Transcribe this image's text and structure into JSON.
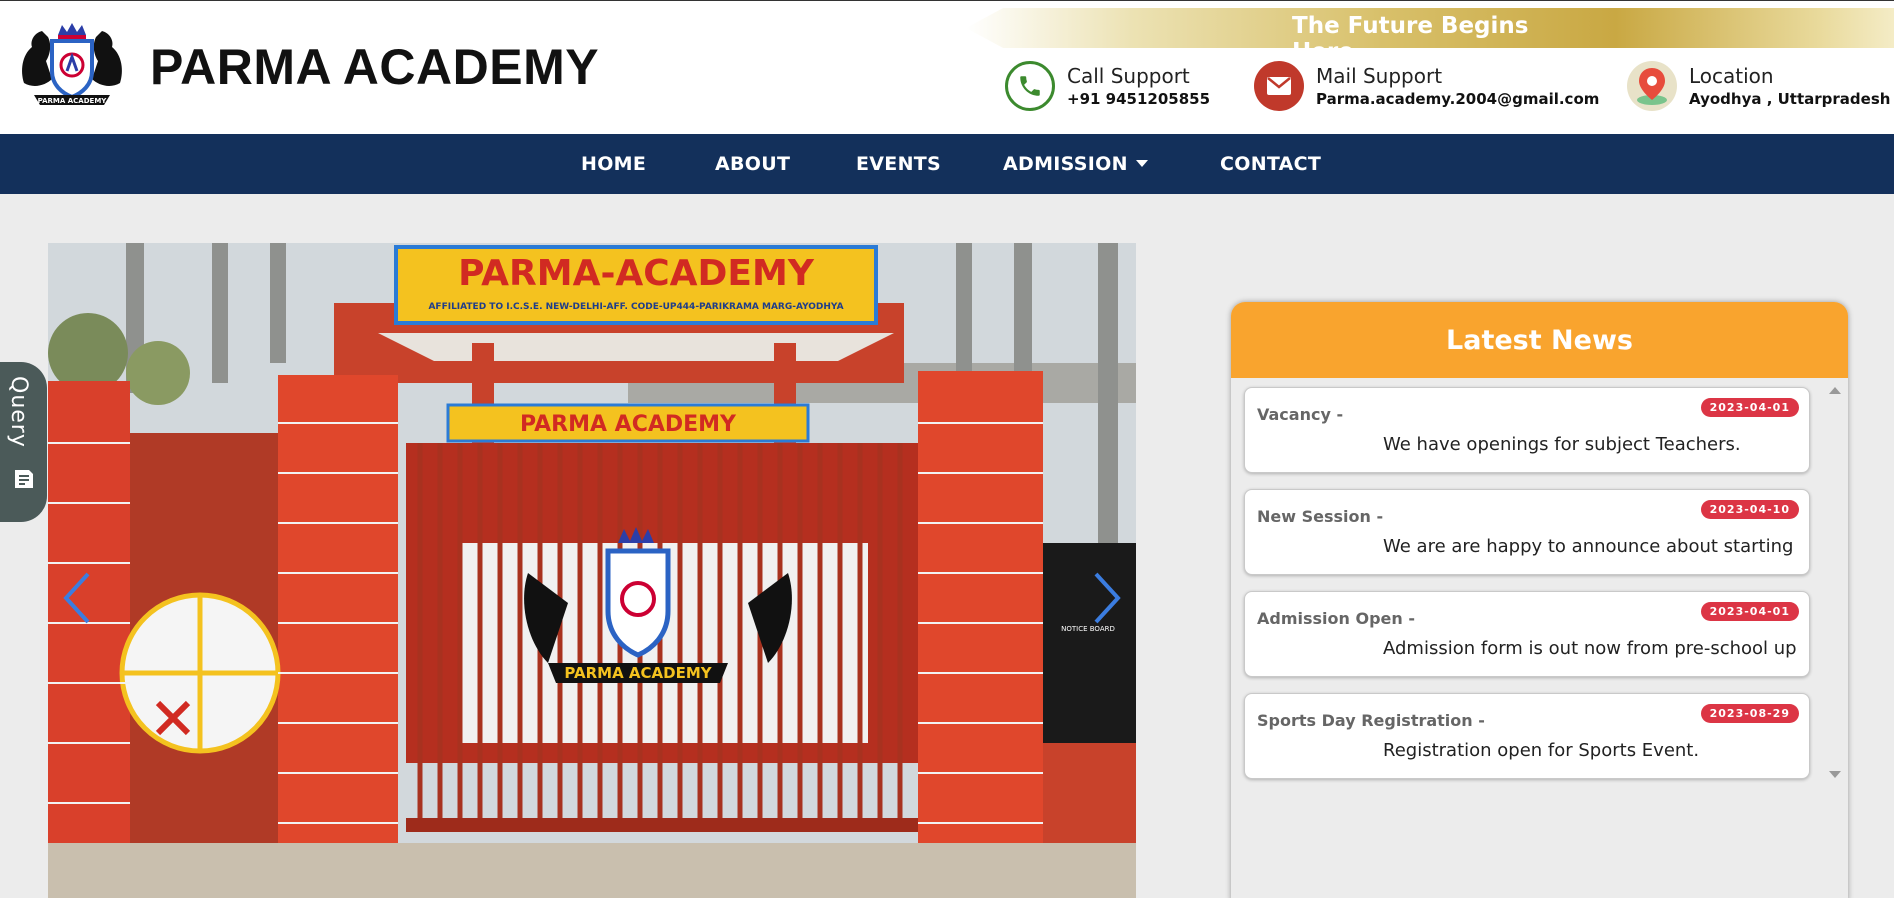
{
  "brand": {
    "name": "PARMA ACADEMY",
    "logo_icon": "parma-crest-logo",
    "logo_text": "PARMA ACADEMY"
  },
  "tagline": "The Future Begins Here",
  "contacts": [
    {
      "title": "Call Support",
      "value": "+91 9451205855",
      "icon": "phone-icon",
      "color": "#3c8a2e"
    },
    {
      "title": "Mail Support",
      "value": "Parma.academy.2004@gmail.com",
      "icon": "mail-icon",
      "color": "#c0392b"
    },
    {
      "title": "Location",
      "value": "Ayodhya , Uttarpradesh",
      "icon": "location-pin-icon",
      "color": "#e74c3c"
    }
  ],
  "nav": {
    "home": "HOME",
    "about": "ABOUT",
    "events": "EVENTS",
    "admission": "ADMISSION",
    "contact": "CONTACT"
  },
  "carousel": {
    "sign_main": "PARMA-ACADEMY",
    "sign_sub": "AFFILIATED TO I.C.S.E. NEW-DELHI-AFF. CODE-UP444-PARIKRAMA MARG-AYODHYA",
    "sign_inner": "PARMA ACADEMY",
    "gate_logo_text": "PARMA ACADEMY",
    "notice_board": "NOTICE BOARD"
  },
  "query": {
    "label": "Query",
    "icon": "note-icon"
  },
  "news": {
    "title": "Latest News",
    "items": [
      {
        "heading": "Vacancy -",
        "date": "2023-04-01",
        "body": "We have openings for subject Teachers."
      },
      {
        "heading": "New Session -",
        "date": "2023-04-10",
        "body": "We are are happy to announce about starting of new session"
      },
      {
        "heading": "Admission Open -",
        "date": "2023-04-01",
        "body": "Admission form is out now from pre-school up to"
      },
      {
        "heading": "Sports Day Registration -",
        "date": "2023-08-29",
        "body": "Registration open for Sports Event."
      }
    ]
  },
  "colors": {
    "nav_bg": "#13305b",
    "news_header": "#f9a42e",
    "date_badge": "#dc3545",
    "accent_gold": "#c9a843"
  }
}
